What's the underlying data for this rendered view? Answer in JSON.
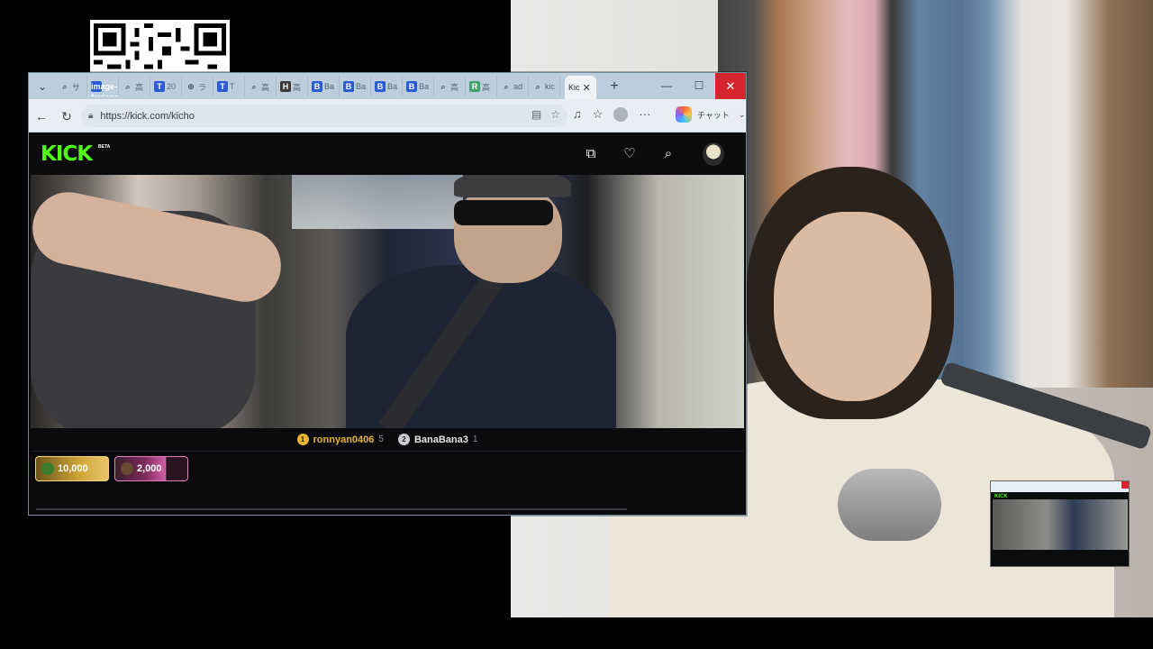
{
  "browser": {
    "tabs": [
      {
        "favicon": "search-icon",
        "title": "サ"
      },
      {
        "favicon": "image-favicon",
        "title": ""
      },
      {
        "favicon": "search-icon",
        "title": "高"
      },
      {
        "favicon": "T",
        "title": "20"
      },
      {
        "favicon": "globe-icon",
        "title": "ラ"
      },
      {
        "favicon": "T",
        "title": "T"
      },
      {
        "favicon": "search-icon",
        "title": "高"
      },
      {
        "favicon": "H",
        "title": "高"
      },
      {
        "favicon": "B",
        "title": "Ba"
      },
      {
        "favicon": "B",
        "title": "Ba"
      },
      {
        "favicon": "B",
        "title": "Ba"
      },
      {
        "favicon": "B",
        "title": "Ba"
      },
      {
        "favicon": "search-icon",
        "title": "高"
      },
      {
        "favicon": "R",
        "title": "高"
      },
      {
        "favicon": "search-icon",
        "title": "ad"
      },
      {
        "favicon": "search-icon",
        "title": "kic"
      }
    ],
    "active_tab": {
      "title": "Kic"
    },
    "url": "https://kick.com/kicho",
    "copilot_label": "チャット"
  },
  "kick": {
    "logo": "KICK",
    "beta": "BETA",
    "leaderboard": [
      {
        "rank": "1",
        "name": "ronnyan0406",
        "count": "5"
      },
      {
        "rank": "2",
        "name": "BanaBana3",
        "count": "1"
      }
    ],
    "gifts": [
      {
        "amount": "10,000"
      },
      {
        "amount": "2,000"
      }
    ]
  },
  "mini_preview": {
    "logo": "KICK"
  },
  "colors": {
    "kick_green": "#53fc18",
    "close_red": "#d6252c",
    "rank_gold": "#e9b633"
  }
}
